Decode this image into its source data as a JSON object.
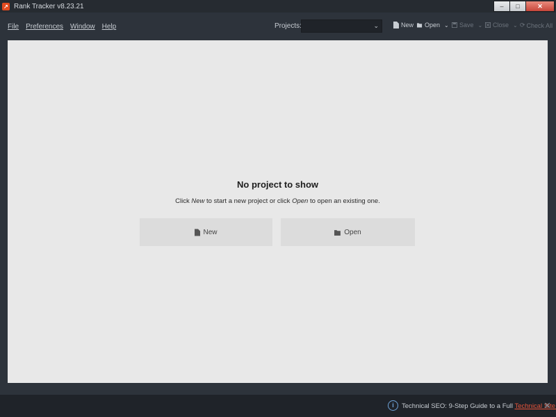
{
  "window": {
    "title": "Rank Tracker v8.23.21",
    "controls": {
      "minimize": "–",
      "maximize": "□",
      "close": "✕"
    }
  },
  "menu": {
    "items": [
      {
        "label": "File"
      },
      {
        "label": "Preferences"
      },
      {
        "label": "Window"
      },
      {
        "label": "Help"
      }
    ]
  },
  "toolbar": {
    "projects_label": "Projects:",
    "project_selected": "",
    "new_label": "New",
    "open_label": "Open",
    "save_label": "Save",
    "close_label": "Close",
    "check_all_label": "Check All"
  },
  "main": {
    "empty_title": "No project to show",
    "empty_sub_part1": "Click ",
    "empty_sub_new": "New",
    "empty_sub_part2": " to start a new project or click ",
    "empty_sub_open": "Open",
    "empty_sub_part3": " to open an existing one.",
    "new_button_label": "New",
    "open_button_label": "Open"
  },
  "footer": {
    "message": "Technical SEO: 9-Step Guide to a Full ",
    "link": "Technical Site Audit"
  },
  "colors": {
    "accent": "#e8543a",
    "background": "#2d333b",
    "panel": "#e8e8e8"
  }
}
